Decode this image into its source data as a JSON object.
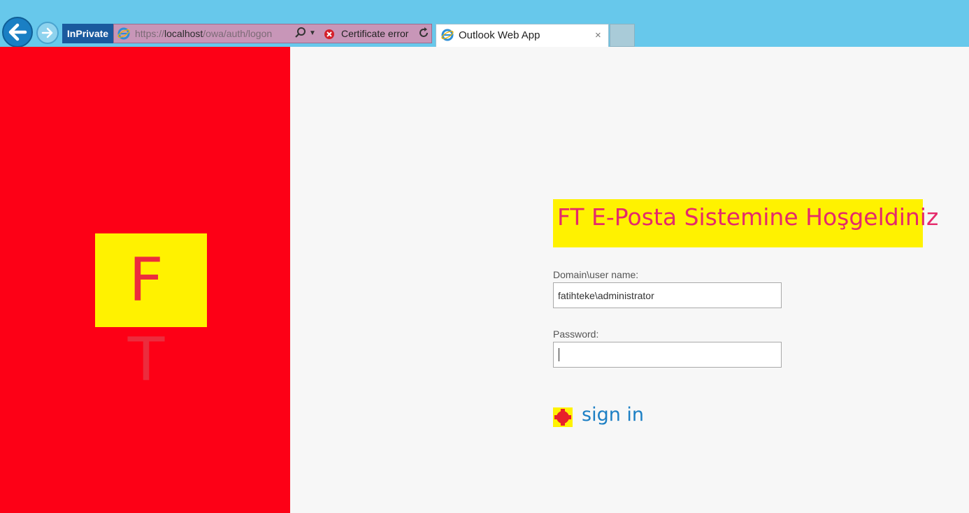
{
  "browser": {
    "inprivate_label": "InPrivate",
    "url_prefix": "https://",
    "url_host": "localhost",
    "url_path": "/owa/auth/logon",
    "cert_error_label": "Certificate error",
    "tab_title": "Outlook Web App",
    "tab_close": "×"
  },
  "brand": {
    "logo_text": "F T",
    "panel_color": "#fd0016",
    "logo_bg": "#fff200",
    "logo_fg": "#ec2c3d"
  },
  "signin": {
    "welcome_text": "FT E-Posta Sistemine Hoşgeldiniz",
    "username_label": "Domain\\user name:",
    "username_value": "fatihteke\\administrator",
    "password_label": "Password:",
    "password_value": "",
    "signin_label": "sign in",
    "accent_color": "#1c7fc4"
  },
  "icons": {
    "back": "arrow-left-icon",
    "forward": "arrow-right-icon",
    "site": "ie-icon",
    "search": "search-icon",
    "cert": "error-x-icon",
    "refresh": "refresh-icon",
    "signin": "signin-arrow-icon"
  }
}
